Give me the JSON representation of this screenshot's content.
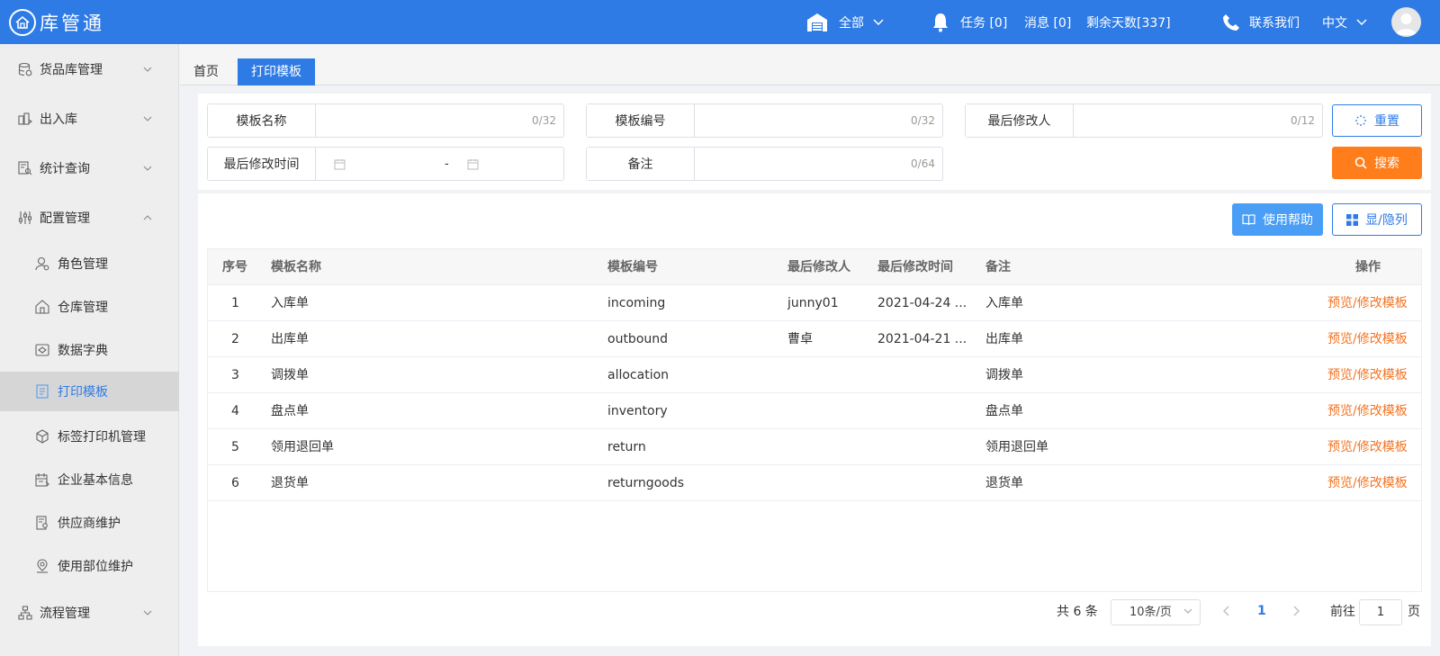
{
  "app": {
    "title": "库管通"
  },
  "header": {
    "warehouse_label": "全部",
    "tasks": "任务 [0]",
    "messages": "消息 [0]",
    "days_left": "剩余天数[337]",
    "contact": "联系我们",
    "language": "中文"
  },
  "sidebar": {
    "menu": [
      {
        "label": "货品库管理"
      },
      {
        "label": "出入库"
      },
      {
        "label": "统计查询"
      },
      {
        "label": "配置管理"
      }
    ],
    "submenu": [
      {
        "label": "角色管理"
      },
      {
        "label": "仓库管理"
      },
      {
        "label": "数据字典"
      },
      {
        "label": "打印模板"
      },
      {
        "label": "标签打印机管理"
      },
      {
        "label": "企业基本信息"
      },
      {
        "label": "供应商维护"
      },
      {
        "label": "使用部位维护"
      }
    ],
    "bottom": {
      "label": "流程管理"
    }
  },
  "tabs": {
    "home": "首页",
    "active": "打印模板"
  },
  "filters": {
    "template_name": {
      "label": "模板名称",
      "count": "0/32"
    },
    "template_code": {
      "label": "模板编号",
      "count": "0/32"
    },
    "last_modifier": {
      "label": "最后修改人",
      "count": "0/12"
    },
    "last_modified_time": {
      "label": "最后修改时间",
      "separator": "-"
    },
    "remark": {
      "label": "备注",
      "count": "0/64"
    },
    "reset_label": "重置",
    "search_label": "搜索"
  },
  "toolbar": {
    "help_label": "使用帮助",
    "columns_label": "显/隐列"
  },
  "table": {
    "headers": [
      "序号",
      "模板名称",
      "模板编号",
      "最后修改人",
      "最后修改时间",
      "备注",
      "操作"
    ],
    "rows": [
      {
        "no": "1",
        "name": "入库单",
        "code": "incoming",
        "modifier": "junny01",
        "time": "2021-04-24 ...",
        "remark": "入库单",
        "action": "预览/修改模板"
      },
      {
        "no": "2",
        "name": "出库单",
        "code": "outbound",
        "modifier": "曹卓",
        "time": "2021-04-21 ...",
        "remark": "出库单",
        "action": "预览/修改模板"
      },
      {
        "no": "3",
        "name": "调拨单",
        "code": "allocation",
        "modifier": "",
        "time": "",
        "remark": "调拨单",
        "action": "预览/修改模板"
      },
      {
        "no": "4",
        "name": "盘点单",
        "code": "inventory",
        "modifier": "",
        "time": "",
        "remark": "盘点单",
        "action": "预览/修改模板"
      },
      {
        "no": "5",
        "name": "领用退回单",
        "code": "return",
        "modifier": "",
        "time": "",
        "remark": "领用退回单",
        "action": "预览/修改模板"
      },
      {
        "no": "6",
        "name": "退货单",
        "code": "returngoods",
        "modifier": "",
        "time": "",
        "remark": "退货单",
        "action": "预览/修改模板"
      }
    ]
  },
  "pagination": {
    "total": "共 6 条",
    "page_size": "10条/页",
    "current_page": "1",
    "goto_prefix": "前往",
    "goto_value": "1",
    "goto_suffix": "页"
  },
  "colors": {
    "primary": "#2f7be5",
    "orange": "#ff7d1a",
    "action": "#f5731f"
  }
}
